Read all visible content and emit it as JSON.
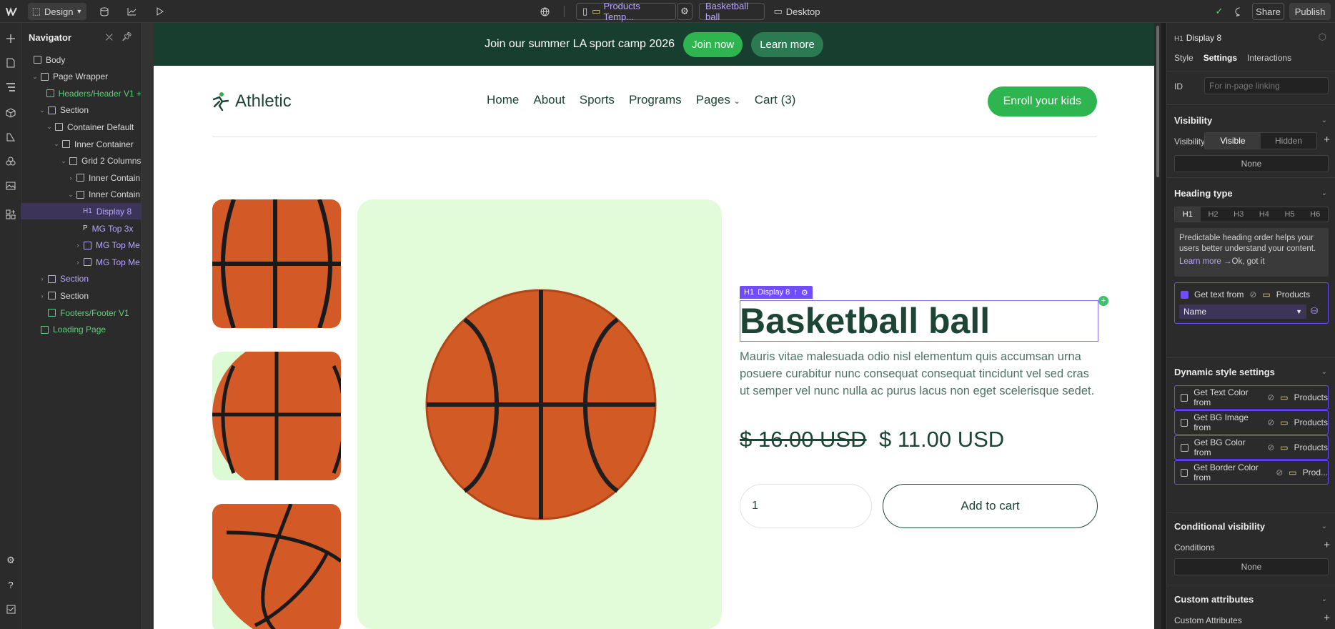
{
  "topbar": {
    "mode": "Design",
    "page_tab": "Products Temp...",
    "item_tab": "Basketball ball",
    "breakpoint": "Desktop",
    "share": "Share",
    "publish": "Publish"
  },
  "navigator": {
    "title": "Navigator",
    "items": [
      {
        "label": "Body",
        "depth": 0
      },
      {
        "label": "Page Wrapper",
        "depth": 1
      },
      {
        "label": "Headers/Header V1 +",
        "depth": 2
      },
      {
        "label": "Section",
        "depth": 2
      },
      {
        "label": "Container Default",
        "depth": 3
      },
      {
        "label": "Inner Container",
        "depth": 4
      },
      {
        "label": "Grid 2 Columns",
        "depth": 5
      },
      {
        "label": "Inner Contain",
        "depth": 6
      },
      {
        "label": "Inner Contain",
        "depth": 6
      },
      {
        "label": "Display 8",
        "prefix": "H1",
        "depth": 7
      },
      {
        "label": "MG Top 3x",
        "prefix": "P",
        "depth": 7
      },
      {
        "label": "MG Top Me",
        "depth": 7
      },
      {
        "label": "MG Top Me",
        "depth": 7
      },
      {
        "label": "Section",
        "depth": 2
      },
      {
        "label": "Section",
        "depth": 2
      },
      {
        "label": "Footers/Footer V1",
        "depth": 2
      },
      {
        "label": "Loading Page",
        "depth": 1
      }
    ]
  },
  "site": {
    "banner_text": "Join our summer LA sport camp 2026",
    "banner_join": "Join now",
    "banner_learn": "Learn more",
    "logo": "Athletic",
    "menu": [
      "Home",
      "About",
      "Sports",
      "Programs",
      "Pages",
      "Cart (3)"
    ],
    "enroll": "Enroll your kids",
    "element_tag": "Display 8",
    "element_tag_prefix": "H1",
    "title": "Basketball ball",
    "description": "Mauris vitae malesuada odio nisl elementum quis accumsan urna posuere curabitur nunc consequat consequat tincidunt vel sed cras ut semper vel nunc nulla ac purus lacus non eget scelerisque sedet.",
    "price_old": "$ 16.00 USD",
    "price_new": "$ 11.00 USD",
    "quantity": "1",
    "add_to_cart": "Add to cart"
  },
  "panel": {
    "element_title": "Display 8",
    "element_prefix": "H1",
    "tabs": [
      "Style",
      "Settings",
      "Interactions"
    ],
    "id_label": "ID",
    "id_placeholder": "For in-page linking",
    "visibility_title": "Visibility",
    "visibility_label": "Visibility",
    "visible": "Visible",
    "hidden": "Hidden",
    "none": "None",
    "heading_title": "Heading type",
    "headings": [
      "H1",
      "H2",
      "H3",
      "H4",
      "H5",
      "H6"
    ],
    "heading_tip": "Predictable heading order helps your users better understand your content.",
    "learn_more": "Learn more →",
    "ok_got_it": "Ok, got it",
    "get_text_from": "Get text from",
    "products": "Products",
    "name_field": "Name",
    "dynamic_title": "Dynamic style settings",
    "dynamic": [
      "Get Text Color from",
      "Get BG Image from",
      "Get BG Color from",
      "Get Border Color from"
    ],
    "dynamic_sources": [
      "Products",
      "Products",
      "Products",
      "Prod..."
    ],
    "conditional_title": "Conditional visibility",
    "conditions": "Conditions",
    "custom_title": "Custom attributes",
    "custom_label": "Custom Attributes"
  },
  "colors": {
    "accent": "#6f4dff",
    "brand_green": "#2fb54f",
    "dark_green": "#173e2f"
  }
}
